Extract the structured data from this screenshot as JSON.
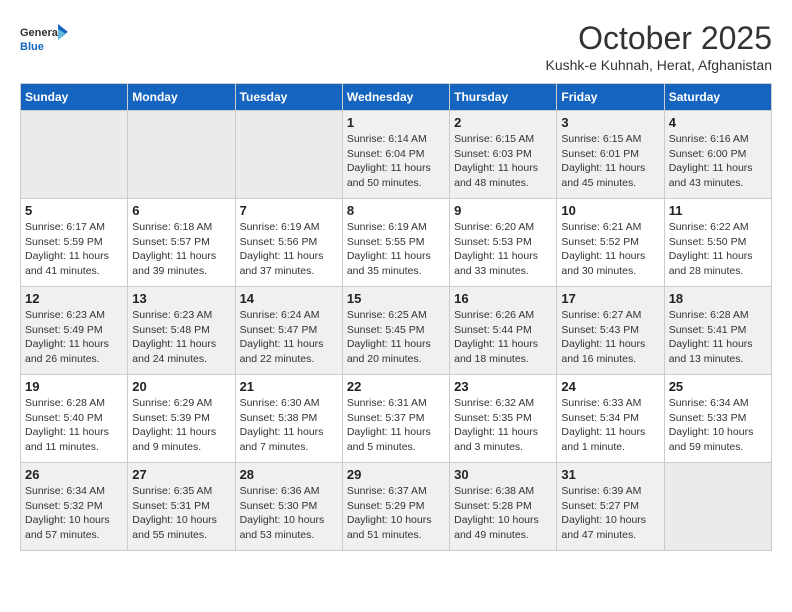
{
  "logo": {
    "general": "General",
    "blue": "Blue"
  },
  "title": "October 2025",
  "subtitle": "Kushk-e Kuhnah, Herat, Afghanistan",
  "weekdays": [
    "Sunday",
    "Monday",
    "Tuesday",
    "Wednesday",
    "Thursday",
    "Friday",
    "Saturday"
  ],
  "weeks": [
    [
      {
        "day": "",
        "info": ""
      },
      {
        "day": "",
        "info": ""
      },
      {
        "day": "",
        "info": ""
      },
      {
        "day": "1",
        "info": "Sunrise: 6:14 AM\nSunset: 6:04 PM\nDaylight: 11 hours\nand 50 minutes."
      },
      {
        "day": "2",
        "info": "Sunrise: 6:15 AM\nSunset: 6:03 PM\nDaylight: 11 hours\nand 48 minutes."
      },
      {
        "day": "3",
        "info": "Sunrise: 6:15 AM\nSunset: 6:01 PM\nDaylight: 11 hours\nand 45 minutes."
      },
      {
        "day": "4",
        "info": "Sunrise: 6:16 AM\nSunset: 6:00 PM\nDaylight: 11 hours\nand 43 minutes."
      }
    ],
    [
      {
        "day": "5",
        "info": "Sunrise: 6:17 AM\nSunset: 5:59 PM\nDaylight: 11 hours\nand 41 minutes."
      },
      {
        "day": "6",
        "info": "Sunrise: 6:18 AM\nSunset: 5:57 PM\nDaylight: 11 hours\nand 39 minutes."
      },
      {
        "day": "7",
        "info": "Sunrise: 6:19 AM\nSunset: 5:56 PM\nDaylight: 11 hours\nand 37 minutes."
      },
      {
        "day": "8",
        "info": "Sunrise: 6:19 AM\nSunset: 5:55 PM\nDaylight: 11 hours\nand 35 minutes."
      },
      {
        "day": "9",
        "info": "Sunrise: 6:20 AM\nSunset: 5:53 PM\nDaylight: 11 hours\nand 33 minutes."
      },
      {
        "day": "10",
        "info": "Sunrise: 6:21 AM\nSunset: 5:52 PM\nDaylight: 11 hours\nand 30 minutes."
      },
      {
        "day": "11",
        "info": "Sunrise: 6:22 AM\nSunset: 5:50 PM\nDaylight: 11 hours\nand 28 minutes."
      }
    ],
    [
      {
        "day": "12",
        "info": "Sunrise: 6:23 AM\nSunset: 5:49 PM\nDaylight: 11 hours\nand 26 minutes."
      },
      {
        "day": "13",
        "info": "Sunrise: 6:23 AM\nSunset: 5:48 PM\nDaylight: 11 hours\nand 24 minutes."
      },
      {
        "day": "14",
        "info": "Sunrise: 6:24 AM\nSunset: 5:47 PM\nDaylight: 11 hours\nand 22 minutes."
      },
      {
        "day": "15",
        "info": "Sunrise: 6:25 AM\nSunset: 5:45 PM\nDaylight: 11 hours\nand 20 minutes."
      },
      {
        "day": "16",
        "info": "Sunrise: 6:26 AM\nSunset: 5:44 PM\nDaylight: 11 hours\nand 18 minutes."
      },
      {
        "day": "17",
        "info": "Sunrise: 6:27 AM\nSunset: 5:43 PM\nDaylight: 11 hours\nand 16 minutes."
      },
      {
        "day": "18",
        "info": "Sunrise: 6:28 AM\nSunset: 5:41 PM\nDaylight: 11 hours\nand 13 minutes."
      }
    ],
    [
      {
        "day": "19",
        "info": "Sunrise: 6:28 AM\nSunset: 5:40 PM\nDaylight: 11 hours\nand 11 minutes."
      },
      {
        "day": "20",
        "info": "Sunrise: 6:29 AM\nSunset: 5:39 PM\nDaylight: 11 hours\nand 9 minutes."
      },
      {
        "day": "21",
        "info": "Sunrise: 6:30 AM\nSunset: 5:38 PM\nDaylight: 11 hours\nand 7 minutes."
      },
      {
        "day": "22",
        "info": "Sunrise: 6:31 AM\nSunset: 5:37 PM\nDaylight: 11 hours\nand 5 minutes."
      },
      {
        "day": "23",
        "info": "Sunrise: 6:32 AM\nSunset: 5:35 PM\nDaylight: 11 hours\nand 3 minutes."
      },
      {
        "day": "24",
        "info": "Sunrise: 6:33 AM\nSunset: 5:34 PM\nDaylight: 11 hours\nand 1 minute."
      },
      {
        "day": "25",
        "info": "Sunrise: 6:34 AM\nSunset: 5:33 PM\nDaylight: 10 hours\nand 59 minutes."
      }
    ],
    [
      {
        "day": "26",
        "info": "Sunrise: 6:34 AM\nSunset: 5:32 PM\nDaylight: 10 hours\nand 57 minutes."
      },
      {
        "day": "27",
        "info": "Sunrise: 6:35 AM\nSunset: 5:31 PM\nDaylight: 10 hours\nand 55 minutes."
      },
      {
        "day": "28",
        "info": "Sunrise: 6:36 AM\nSunset: 5:30 PM\nDaylight: 10 hours\nand 53 minutes."
      },
      {
        "day": "29",
        "info": "Sunrise: 6:37 AM\nSunset: 5:29 PM\nDaylight: 10 hours\nand 51 minutes."
      },
      {
        "day": "30",
        "info": "Sunrise: 6:38 AM\nSunset: 5:28 PM\nDaylight: 10 hours\nand 49 minutes."
      },
      {
        "day": "31",
        "info": "Sunrise: 6:39 AM\nSunset: 5:27 PM\nDaylight: 10 hours\nand 47 minutes."
      },
      {
        "day": "",
        "info": ""
      }
    ]
  ]
}
